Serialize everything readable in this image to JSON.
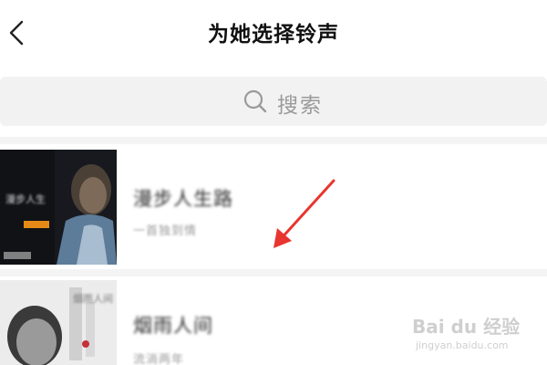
{
  "header": {
    "title": "为她选择铃声",
    "back_icon": "chevron-left-icon"
  },
  "search": {
    "placeholder": "搜索",
    "icon": "search-icon"
  },
  "songs": [
    {
      "title": "漫步人生路",
      "subtitle": "一首独到情",
      "cover_text": "漫步人生"
    },
    {
      "title": "烟雨人间",
      "subtitle": "流淌两年",
      "cover_text": "烟雨人间"
    }
  ],
  "annotation": {
    "color": "#e8352f"
  },
  "watermark": {
    "brand": "Bai du 经验",
    "url": "jingyan.baidu.com"
  }
}
